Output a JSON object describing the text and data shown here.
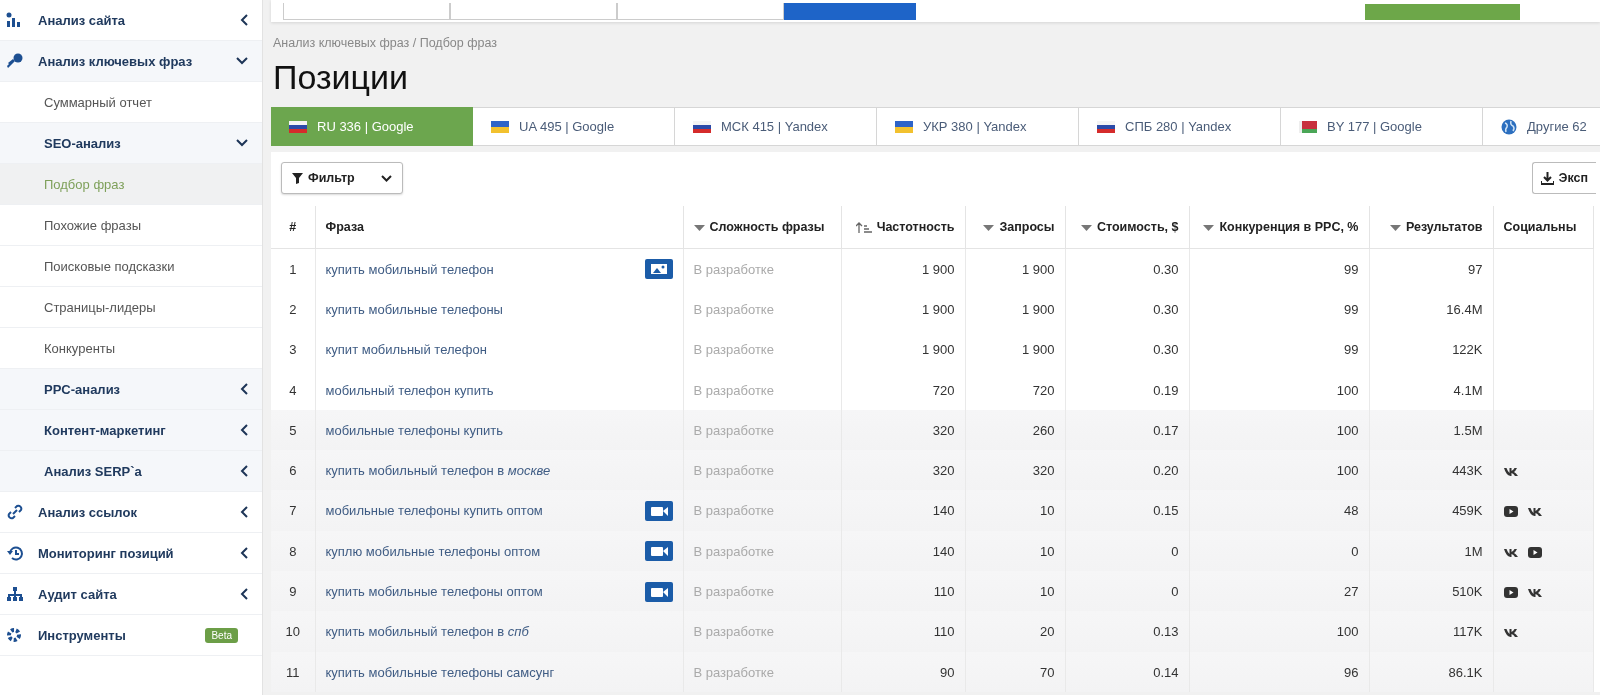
{
  "sidebar": {
    "items": [
      {
        "label": "Анализ сайта",
        "kind": "section",
        "expanded": false,
        "selected": false
      },
      {
        "label": "Анализ ключевых фраз",
        "kind": "section",
        "expanded": true,
        "selected": false
      },
      {
        "label": "Суммарный отчет",
        "kind": "sub",
        "selected": false
      },
      {
        "label": "SEO-анализ",
        "kind": "group",
        "expanded": true,
        "selected": false
      },
      {
        "label": "Подбор фраз",
        "kind": "sub",
        "selected": true
      },
      {
        "label": "Похожие фразы",
        "kind": "sub",
        "selected": false
      },
      {
        "label": "Поисковые подсказки",
        "kind": "sub",
        "selected": false
      },
      {
        "label": "Страницы-лидеры",
        "kind": "sub",
        "selected": false
      },
      {
        "label": "Конкуренты",
        "kind": "sub",
        "selected": false
      },
      {
        "label": "PPC-анализ",
        "kind": "group",
        "expanded": false,
        "selected": false
      },
      {
        "label": "Контент-маркетинг",
        "kind": "group",
        "expanded": false,
        "selected": false
      },
      {
        "label": "Анализ SERP`a",
        "kind": "group",
        "expanded": false,
        "selected": false
      },
      {
        "label": "Анализ ссылок",
        "kind": "section",
        "expanded": false,
        "selected": false
      },
      {
        "label": "Мониторинг позиций",
        "kind": "section",
        "expanded": false,
        "selected": false
      },
      {
        "label": "Аудит сайта",
        "kind": "section",
        "expanded": false,
        "selected": false
      },
      {
        "label": "Инструменты",
        "kind": "section",
        "badge": "Beta",
        "selected": false
      }
    ]
  },
  "breadcrumb": "Анализ ключевых фраз / Подбор фраз",
  "title": "Позиции",
  "tabs": [
    {
      "label": "RU 336 | Google",
      "selected": true
    },
    {
      "label": "UA 495 | Google",
      "selected": false
    },
    {
      "label": "МСК 415 | Yandex",
      "selected": false
    },
    {
      "label": "УКР 380 | Yandex",
      "selected": false
    },
    {
      "label": "СПБ 280 | Yandex",
      "selected": false
    },
    {
      "label": "BY 177 | Google",
      "selected": false
    },
    {
      "label": "Другие 62",
      "selected": false
    }
  ],
  "filter_button": "Фильтр",
  "export_button": "Эксп",
  "table": {
    "columns": [
      {
        "label": "#",
        "kind": "plain"
      },
      {
        "label": "Фраза",
        "kind": "plain"
      },
      {
        "label": "Сложность фразы",
        "kind": "desc"
      },
      {
        "label": "Частотность",
        "kind": "asc"
      },
      {
        "label": "Запросы",
        "kind": "desc"
      },
      {
        "label": "Стоимость, $",
        "kind": "desc"
      },
      {
        "label": "Конкуренция в PPC, %",
        "kind": "desc"
      },
      {
        "label": "Результатов",
        "kind": "desc"
      },
      {
        "label": "Социальны",
        "kind": "plain"
      }
    ],
    "rows": [
      {
        "n": "1",
        "phrase": "купить мобильный телефон",
        "kind": "image",
        "difficulty": "В разработке",
        "frequency": "1 900",
        "requests": "1 900",
        "cost": "0.30",
        "ppc": "99",
        "results": "97",
        "social": []
      },
      {
        "n": "2",
        "phrase": "купить мобильные телефоны",
        "kind": "plain",
        "difficulty": "В разработке",
        "frequency": "1 900",
        "requests": "1 900",
        "cost": "0.30",
        "ppc": "99",
        "results": "16.4M",
        "social": []
      },
      {
        "n": "3",
        "phrase": "купит мобильный телефон",
        "kind": "plain",
        "difficulty": "В разработке",
        "frequency": "1 900",
        "requests": "1 900",
        "cost": "0.30",
        "ppc": "99",
        "results": "122K",
        "social": []
      },
      {
        "n": "4",
        "phrase": "мобильный телефон купить",
        "kind": "plain",
        "difficulty": "В разработке",
        "frequency": "720",
        "requests": "720",
        "cost": "0.19",
        "ppc": "100",
        "results": "4.1M",
        "social": []
      },
      {
        "n": "5",
        "phrase": "мобильные телефоны купить",
        "kind": "plain",
        "difficulty": "В разработке",
        "frequency": "320",
        "requests": "260",
        "cost": "0.17",
        "ppc": "100",
        "results": "1.5M",
        "social": []
      },
      {
        "n": "6",
        "phrase": "купить мобильный телефон в *москве*",
        "kind": "plain",
        "difficulty": "В разработке",
        "frequency": "320",
        "requests": "320",
        "cost": "0.20",
        "ppc": "100",
        "results": "443K",
        "social": [
          {
            "kind": "vk"
          }
        ]
      },
      {
        "n": "7",
        "phrase": "мобильные телефоны купить оптом",
        "kind": "video",
        "difficulty": "В разработке",
        "frequency": "140",
        "requests": "10",
        "cost": "0.15",
        "ppc": "48",
        "results": "459K",
        "social": [
          {
            "kind": "youtube"
          },
          {
            "kind": "vk"
          }
        ]
      },
      {
        "n": "8",
        "phrase": "куплю мобильные телефоны оптом",
        "kind": "video",
        "difficulty": "В разработке",
        "frequency": "140",
        "requests": "10",
        "cost": "0",
        "ppc": "0",
        "results": "1M",
        "social": [
          {
            "kind": "vk"
          },
          {
            "kind": "youtube"
          }
        ]
      },
      {
        "n": "9",
        "phrase": "купить мобильные телефоны оптом",
        "kind": "video",
        "difficulty": "В разработке",
        "frequency": "110",
        "requests": "10",
        "cost": "0",
        "ppc": "27",
        "results": "510K",
        "social": [
          {
            "kind": "youtube"
          },
          {
            "kind": "vk"
          }
        ]
      },
      {
        "n": "10",
        "phrase": "купить мобильный телефон в *спб*",
        "kind": "plain",
        "difficulty": "В разработке",
        "frequency": "110",
        "requests": "20",
        "cost": "0.13",
        "ppc": "100",
        "results": "117K",
        "social": [
          {
            "kind": "vk"
          }
        ]
      },
      {
        "n": "11",
        "phrase": "купить мобильные телефоны самсунг",
        "kind": "plain",
        "difficulty": "В разработке",
        "frequency": "90",
        "requests": "70",
        "cost": "0.14",
        "ppc": "96",
        "results": "86.1K",
        "social": []
      }
    ]
  }
}
